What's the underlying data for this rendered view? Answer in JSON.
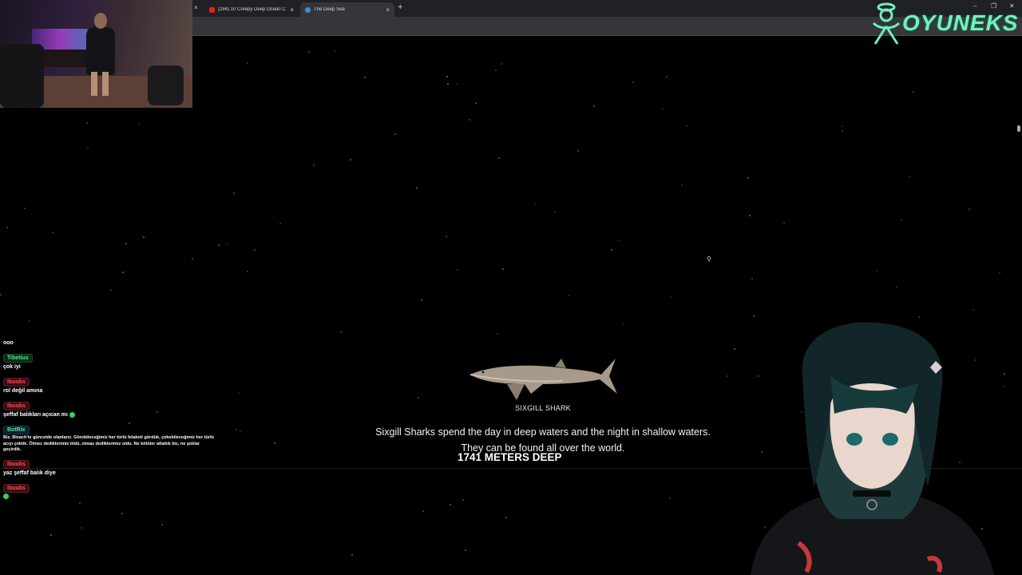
{
  "browser": {
    "tabs": [
      {
        "title": "(284) 10 Creepy Deep Ocean C",
        "favicon": "youtube-icon",
        "active": false
      },
      {
        "title": "The Deep Sea",
        "favicon": "wave-icon",
        "active": true
      }
    ],
    "new_tab_symbol": "+",
    "close_symbol": "×",
    "window_controls": [
      "–",
      "❐",
      "✕"
    ]
  },
  "overlay": {
    "logo_text": "OYUNEKS",
    "logo_color": "#6ef2bd"
  },
  "page": {
    "creature_name": "SIXGILL SHARK",
    "fact_line_1": "Sixgill Sharks spend the day in deep waters and the night in shallow waters.",
    "fact_line_2": "They can be found all over the world.",
    "depth_label": "1741 METERS DEEP",
    "background_color": "#000000"
  },
  "chat": {
    "messages": [
      {
        "user": "",
        "text": "ooo",
        "badge": "none"
      },
      {
        "user": "Tibetius",
        "text": "çok iyi",
        "badge": "green"
      },
      {
        "user": "Ibuubs",
        "text": "rol değil amına",
        "badge": "red"
      },
      {
        "user": "Ibuubs",
        "text": "şeffaf balıkları açıcan mı",
        "badge": "red",
        "emote": true
      },
      {
        "user": "BotRix",
        "text": "Biz, Bleach'te güncelde olanlarız. Görebileceğimiz her türlü felaketi gördük, çekebileceğimiz her türlü acıyı çektik. Ölmez dediklerimiz öldü, olmaz dediklerimiz oldu. Ne kötüler atlattık biz, ne şoklar geçirdik.",
        "badge": "blue",
        "small": true
      },
      {
        "user": "Ibuubs",
        "text": "yaz şeffaf balık diye",
        "badge": "red"
      },
      {
        "user": "Ibuubs",
        "text": "",
        "badge": "red",
        "emote": true
      }
    ]
  }
}
